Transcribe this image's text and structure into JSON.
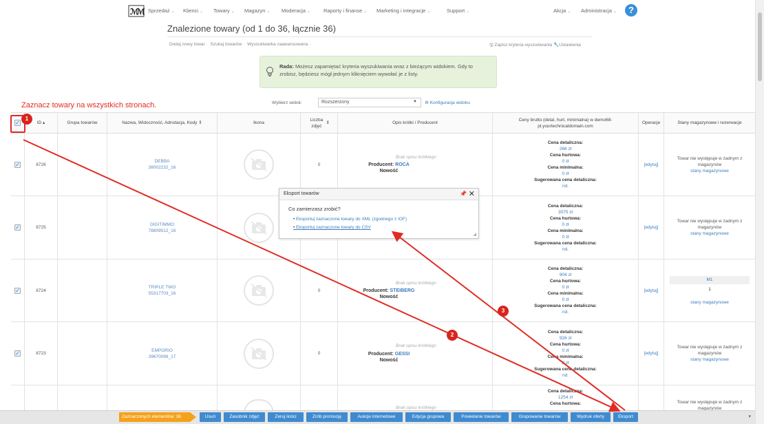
{
  "nav": {
    "items": [
      "Sprzedaż",
      "Klienci",
      "Towary",
      "Magazyn",
      "Moderacja",
      "Raporty i finanse",
      "Marketing i integracje",
      "Support"
    ],
    "right_items": [
      "Akcja",
      "Administracja"
    ],
    "help": "?"
  },
  "page": {
    "title": "Znalezione towary (od 1 do 36, łącznie 36)",
    "links": [
      "Dodaj nowy towar",
      "Szukaj towarów",
      "Wyszukiwarka zaawansowana"
    ],
    "right_links": [
      "Zapisz kryteria wyszukiwania",
      "Ustawienia"
    ]
  },
  "tip": {
    "bold": "Rada:",
    "text": "Możesz zapamiętać kryteria wyszukiwania wraz z bieżącym widokiem. Gdy to zrobisz, będziesz mógł jednym kliknięciem wywołać je z listy."
  },
  "annotation": {
    "mark_all": "Zaznacz towary na wszystkich stronach.",
    "badges": [
      "1",
      "2",
      "3"
    ]
  },
  "view": {
    "label": "Wybierz widok:",
    "selected": "Rozszerzony",
    "config": "Konfiguracja widoku"
  },
  "table": {
    "headers": {
      "id": "ID",
      "group": "Grupa towarów",
      "name": "Nazwa, Widoczność, Adnotacja, Kody",
      "icon": "Ikona",
      "photos": "Liczba zdjęć",
      "desc": "Opis krótki / Producent",
      "prices": "Ceny brutto (detal, hurt, minimalna) w demo68-pl.yourtechnicaldomain.com",
      "ops": "Operacje",
      "stock": "Stany magazynowe i rezerwacje"
    },
    "labels": {
      "retail": "Cena detaliczna:",
      "wholesale": "Cena hurtowa:",
      "minimum": "Cena minimalna:",
      "suggested": "Sugerowana cena detaliczna:",
      "no_desc": "Brak opisu krótkiego",
      "producer": "Producent:",
      "new": "Nowość",
      "edit": "[edytuj]",
      "stock_none": "Towar nie występuje w żadnym z magazynów",
      "stock_link": "stany magazynowe"
    },
    "rows": [
      {
        "id": "8726",
        "name": "DEBBA",
        "code": "38002232_16",
        "photos": "0",
        "producer": "ROCA",
        "retail": "266 zł",
        "wholesale": "0 zł",
        "minimum": "0 zł",
        "suggested": "nd.",
        "stock_code": "",
        "stock_qty": ""
      },
      {
        "id": "8725",
        "name": "DIGITIMMO",
        "code": "78809512_16",
        "photos": "",
        "producer": "",
        "retail": "3075 zł",
        "wholesale": "0 zł",
        "minimum": "0 zł",
        "suggested": "nd.",
        "stock_code": "",
        "stock_qty": ""
      },
      {
        "id": "8724",
        "name": "TRIPLE TWO",
        "code": "55317703_16",
        "photos": "0",
        "producer": "STEIBERG",
        "retail": "904 zł",
        "wholesale": "0 zł",
        "minimum": "0 zł",
        "suggested": "nd.",
        "stock_code": "M1",
        "stock_qty": "1"
      },
      {
        "id": "8723",
        "name": "EMPORIO",
        "code": "39670096_17",
        "photos": "0",
        "producer": "GESSI",
        "retail": "926 zł",
        "wholesale": "0 zł",
        "minimum": "0 zł",
        "suggested": "nd.",
        "stock_code": "",
        "stock_qty": ""
      },
      {
        "id": "",
        "name": "",
        "code": "",
        "photos": "",
        "producer": "",
        "retail": "1254 zł",
        "wholesale": "",
        "minimum": "",
        "suggested": "",
        "stock_code": "",
        "stock_qty": ""
      }
    ]
  },
  "popup": {
    "title": "Eksport towarów",
    "question": "Co zamierzasz zrobić?",
    "options": [
      "Eksportuj zaznaczone towary do XML (zgodnego z IOF)",
      "Eksportuj zaznaczone towary do CSV"
    ]
  },
  "bottom": {
    "count": "Zaznaczonych elementów: 36",
    "buttons": [
      "Usuń",
      "Zasobnik zdjęć",
      "Zeruj ilości",
      "Zrób promocję",
      "Aukcje internetowe",
      "Edycja grupowa",
      "Powielanie towarów",
      "Grupowanie towarów",
      "Wydruk oferty",
      "Eksport"
    ]
  },
  "colors": {
    "accent": "#3f8bd0",
    "annotation": "#e02b24",
    "count": "#f4a21c",
    "tip_bg": "#e7f2dd"
  }
}
